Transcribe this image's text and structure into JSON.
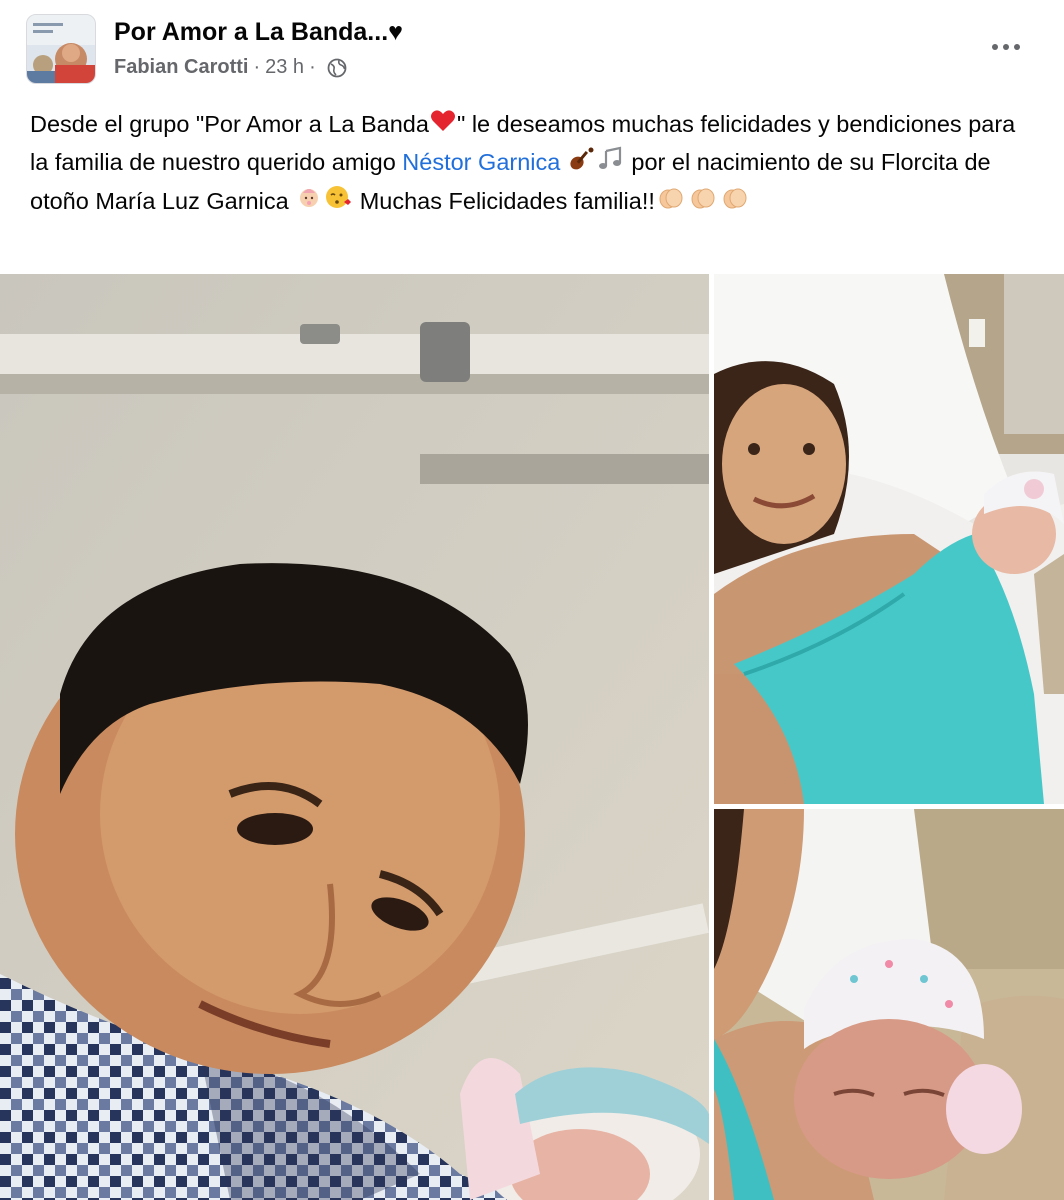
{
  "post": {
    "group_name": "Por Amor a La Banda...♥",
    "author": "Fabian Carotti",
    "separator": "·",
    "time": "23 h",
    "more_label": "•••",
    "text": {
      "part1": "Desde el grupo \"Por Amor a La Banda",
      "part2": "\" le deseamos muchas felicidades y bendiciones para la familia de nuestro querido amigo ",
      "mention": "Néstor Garnica",
      "part3": " por el nacimiento de su Florcita de otoño María Luz Garnica ",
      "part4": " Muchas Felicidades familia!!"
    },
    "icons": {
      "privacy": "globe-icon",
      "more": "more-options-icon",
      "emojis": [
        "red-heart-icon",
        "violin-icon",
        "music-notes-icon",
        "baby-icon",
        "kissing-face-icon",
        "clapping-hands-icon"
      ]
    },
    "photos": [
      {
        "name": "photo-father-with-newborn"
      },
      {
        "name": "photo-mother-with-newborn"
      },
      {
        "name": "photo-newborn-close-up"
      }
    ]
  },
  "colors": {
    "mention": "#216fdb",
    "meta_text": "#65676b",
    "text": "#050505",
    "mother_shirt": "#47c8c8"
  }
}
